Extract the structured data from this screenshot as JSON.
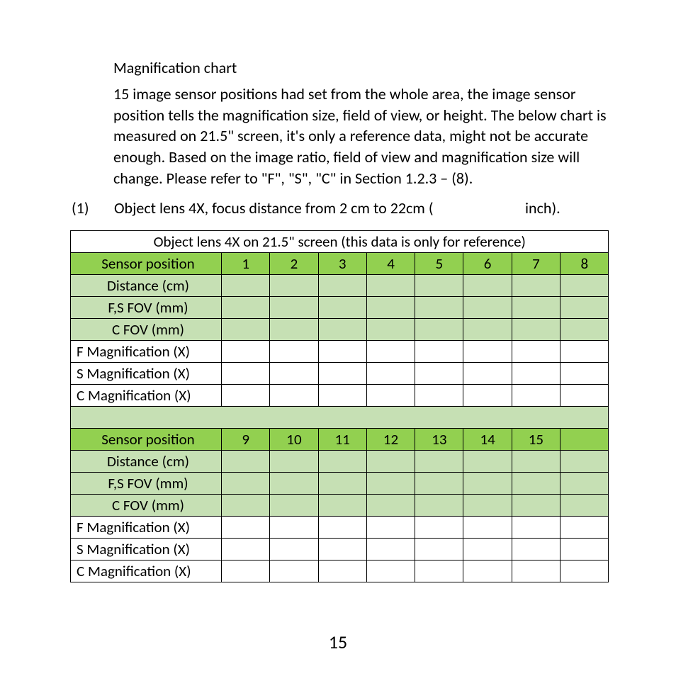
{
  "heading": "Magnification chart",
  "paragraph": "15 image sensor positions had set from the whole area, the image sensor position tells the magnification size, field of view, or height. The below chart is measured on 21.5\" screen, it's only a reference data, might not be accurate enough. Based on the image ratio, field of view and magnification size will change. Please refer to \"F\", \"S\", \"C\" in Section 1.2.3 – (8).",
  "item": {
    "number": "(1)",
    "text": "Object lens 4X, focus distance from 2 cm to 22cm (",
    "inch_text": "inch)."
  },
  "table": {
    "title": "Object lens 4X on 21.5\" screen (this data is only for reference)",
    "row_labels": {
      "sensor": "Sensor position",
      "distance": "Distance (cm)",
      "fs_fov": "F,S FOV (mm)",
      "c_fov": "C FOV (mm)",
      "f_mag": "F Magnification (X)",
      "s_mag": "S Magnification (X)",
      "c_mag": "C Magnification (X)"
    },
    "positions_top": [
      "1",
      "2",
      "3",
      "4",
      "5",
      "6",
      "7",
      "8"
    ],
    "positions_bottom": [
      "9",
      "10",
      "11",
      "12",
      "13",
      "14",
      "15",
      ""
    ],
    "top_block": {
      "distance": [
        "",
        "",
        "",
        "",
        "",
        "",
        "",
        ""
      ],
      "fs_fov": [
        "",
        "",
        "",
        "",
        "",
        "",
        "",
        ""
      ],
      "c_fov": [
        "",
        "",
        "",
        "",
        "",
        "",
        "",
        ""
      ],
      "f_mag": [
        "",
        "",
        "",
        "",
        "",
        "",
        "",
        ""
      ],
      "s_mag": [
        "",
        "",
        "",
        "",
        "",
        "",
        "",
        ""
      ],
      "c_mag": [
        "",
        "",
        "",
        "",
        "",
        "",
        "",
        ""
      ]
    },
    "bottom_block": {
      "distance": [
        "",
        "",
        "",
        "",
        "",
        "",
        "",
        ""
      ],
      "fs_fov": [
        "",
        "",
        "",
        "",
        "",
        "",
        "",
        ""
      ],
      "c_fov": [
        "",
        "",
        "",
        "",
        "",
        "",
        "",
        ""
      ],
      "f_mag": [
        "",
        "",
        "",
        "",
        "",
        "",
        "",
        ""
      ],
      "s_mag": [
        "",
        "",
        "",
        "",
        "",
        "",
        "",
        ""
      ],
      "c_mag": [
        "",
        "",
        "",
        "",
        "",
        "",
        "",
        ""
      ]
    }
  },
  "page_number": "15",
  "chart_data": {
    "type": "table",
    "title": "Object lens 4X on 21.5\" screen (this data is only for reference)",
    "columns": [
      "Sensor position",
      "Distance (cm)",
      "F,S FOV (mm)",
      "C FOV (mm)",
      "F Magnification (X)",
      "S Magnification (X)",
      "C Magnification (X)"
    ],
    "sensor_positions": [
      1,
      2,
      3,
      4,
      5,
      6,
      7,
      8,
      9,
      10,
      11,
      12,
      13,
      14,
      15
    ],
    "note": "All data cells are blank in the source image."
  }
}
